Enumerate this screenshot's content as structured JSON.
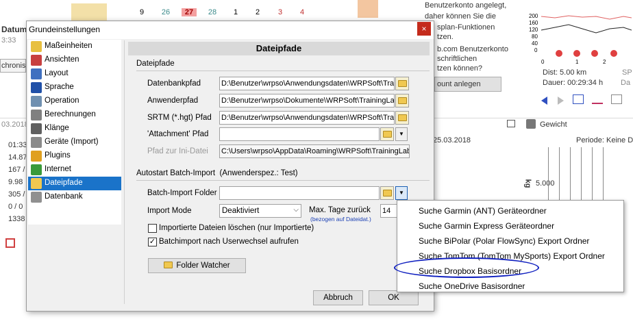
{
  "background": {
    "calendar_days": [
      "9",
      "26",
      "27",
      "28",
      "1",
      "2",
      "3",
      "4"
    ],
    "left_labels": [
      "Datum",
      "3:33",
      "chronisi",
      "03.2018",
      "01:33",
      "14.87",
      "167 /",
      "9.98",
      "305 /",
      "0 / 0",
      "1338"
    ],
    "right_text": [
      "Benutzerkonto angelegt,",
      "daher können Sie die",
      "splan-Funktionen",
      "tzen.",
      "b.com Benutzerkonto",
      "schriftlichen",
      "tzen können?"
    ],
    "account_button": "ount anlegen",
    "distance": "Dist: 5.00 km",
    "duration": "Dauer: 00:29:34 h",
    "sp_label": "SP",
    "da_label": "Da",
    "weight_label": "Gewicht",
    "date": "25.03.2018",
    "period": "Periode: Keine D",
    "kg_label": "kg",
    "kg_value": "5.000",
    "mini_chart_yticks": [
      "200",
      "160",
      "120",
      "80",
      "40",
      "0"
    ],
    "mini_chart_markers": [
      "0",
      "1",
      "2"
    ]
  },
  "dialog": {
    "title": "Grundeinstellungen",
    "close": "×",
    "sidebar": [
      {
        "label": "Maßeinheiten",
        "icon": "ruler-icon",
        "color": "#e8c040"
      },
      {
        "label": "Ansichten",
        "icon": "calendar-icon",
        "color": "#c84040"
      },
      {
        "label": "Layout",
        "icon": "layout-icon",
        "color": "#4070c0"
      },
      {
        "label": "Sprache",
        "icon": "flag-eu-icon",
        "color": "#2050a8"
      },
      {
        "label": "Operation",
        "icon": "wrench-icon",
        "color": "#7090b0"
      },
      {
        "label": "Berechnungen",
        "icon": "calculator-icon",
        "color": "#808080"
      },
      {
        "label": "Klänge",
        "icon": "speaker-icon",
        "color": "#606060"
      },
      {
        "label": "Geräte (Import)",
        "icon": "device-icon",
        "color": "#8a8a8a"
      },
      {
        "label": "Plugins",
        "icon": "puzzle-icon",
        "color": "#e0a020"
      },
      {
        "label": "Internet",
        "icon": "globe-icon",
        "color": "#3a9a3a"
      },
      {
        "label": "Dateipfade",
        "icon": "folder-pencil-icon",
        "color": "#f0c850"
      },
      {
        "label": "Datenbank",
        "icon": "database-icon",
        "color": "#909090"
      }
    ],
    "selected_index": 10,
    "panel_title": "Dateipfade",
    "section_paths": "Dateipfade",
    "fields": [
      {
        "label": "Datenbankpfad",
        "value": "D:\\Benutzer\\wrpso\\Anwendungsdaten\\WRPSoft\\Tra"
      },
      {
        "label": "Anwenderpfad",
        "value": "D:\\Benutzer\\wrpso\\Dokumente\\WRPSoft\\TrainingLa"
      },
      {
        "label": "SRTM (*.hgt) Pfad",
        "value": "D:\\Benutzer\\wrpso\\Anwendungsdaten\\WRPSoft\\Tra"
      },
      {
        "label": "'Attachment' Pfad",
        "value": ""
      },
      {
        "label": "Pfad zur Ini-Datei",
        "value": "C:\\Users\\wrpso\\AppData\\Roaming\\WRPSoft\\TrainingLab"
      }
    ],
    "section_batch": "Autostart Batch-Import",
    "section_batch_note": "(Anwenderspez.: Test)",
    "batch_folder_label": "Batch-Import Folder",
    "batch_folder_value": "",
    "import_mode_label": "Import Mode",
    "import_mode_value": "Deaktiviert",
    "max_days_label": "Max. Tage zurück",
    "max_days_note": "(bezogen auf Dateidat.)",
    "max_days_value": "14",
    "checkbox_delete": {
      "label": "Importierte Dateien löschen (nur Importierte)",
      "checked": false
    },
    "checkbox_userswitch": {
      "label": "Batchimport nach Userwechsel aufrufen",
      "checked": true
    },
    "folder_watcher": "Folder Watcher",
    "cancel": "Abbruch",
    "ok": "OK"
  },
  "popup_menu": [
    "Suche Garmin (ANT) Geräteordner",
    "Suche Garmin Express Geräteordner",
    "Suche BiPolar (Polar FlowSync) Export Ordner",
    "Suche TomTom (TomTom MySports) Export Ordner",
    "Suche Dropbox Basisordner",
    "Suche OneDrive Basisordner"
  ],
  "highlight_color": "#1020c0"
}
